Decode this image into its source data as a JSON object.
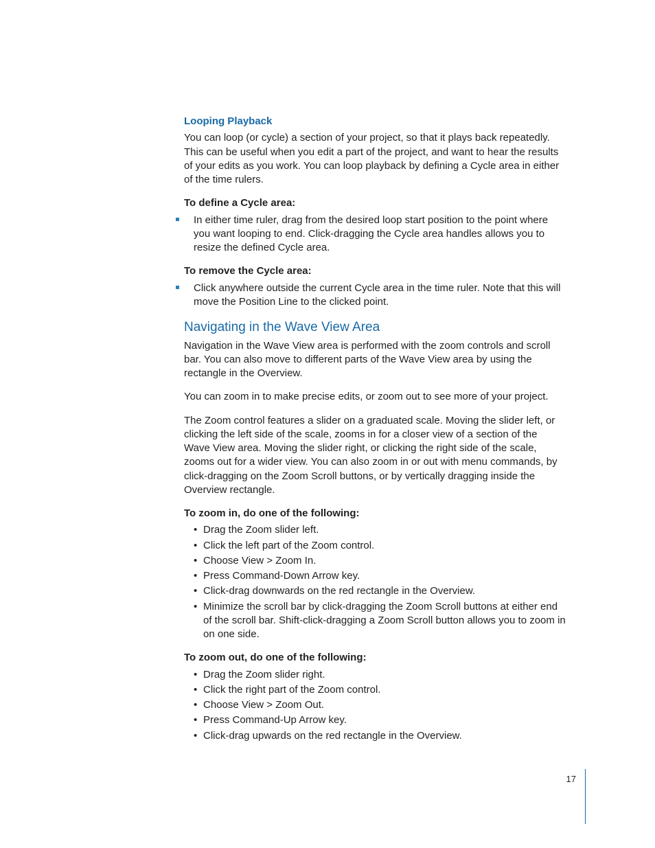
{
  "sec1": {
    "title": "Looping Playback",
    "para": "You can loop (or cycle) a section of your project, so that it plays back repeatedly. This can be useful when you edit a part of the project, and want to hear the results of your edits as you work. You can loop playback by defining a Cycle area in either of the time rulers.",
    "lead1": "To define a Cycle area:",
    "item1": "In either time ruler, drag from the desired loop start position to the point where you want looping to end. Click-dragging the Cycle area handles allows you to resize the defined Cycle area.",
    "lead2": "To remove the Cycle area:",
    "item2": "Click anywhere outside the current Cycle area in the time ruler. Note that this will move the Position Line to the clicked point."
  },
  "sec2": {
    "title": "Navigating in the Wave View Area",
    "para1": "Navigation in the Wave View area is performed with the zoom controls and scroll bar. You can also move to different parts of the Wave View area by using the rectangle in the Overview.",
    "para2": "You can zoom in to make precise edits, or zoom out to see more of your project.",
    "para3": "The Zoom control features a slider on a graduated scale. Moving the slider left, or clicking the left side of the scale, zooms in for a closer view of a section of the Wave View area. Moving the slider right, or clicking the right side of the scale, zooms out for a wider view. You can also zoom in or out with menu commands, by click-dragging on the Zoom Scroll buttons, or by vertically dragging inside the Overview rectangle.",
    "lead3": "To zoom in, do one of the following:",
    "zi": [
      "Drag the Zoom slider left.",
      "Click the left part of the Zoom control.",
      "Choose View > Zoom In.",
      "Press Command-Down Arrow key.",
      "Click-drag downwards on the red rectangle in the Overview.",
      "Minimize the scroll bar by click-dragging the Zoom Scroll buttons at either end of the scroll bar. Shift-click-dragging a Zoom Scroll button allows you to zoom in on one side."
    ],
    "lead4": "To zoom out, do one of the following:",
    "zo": [
      "Drag the Zoom slider right.",
      "Click the right part of the Zoom control.",
      "Choose View > Zoom Out.",
      "Press Command-Up Arrow key.",
      "Click-drag upwards on the red rectangle in the Overview."
    ]
  },
  "pageNumber": "17"
}
